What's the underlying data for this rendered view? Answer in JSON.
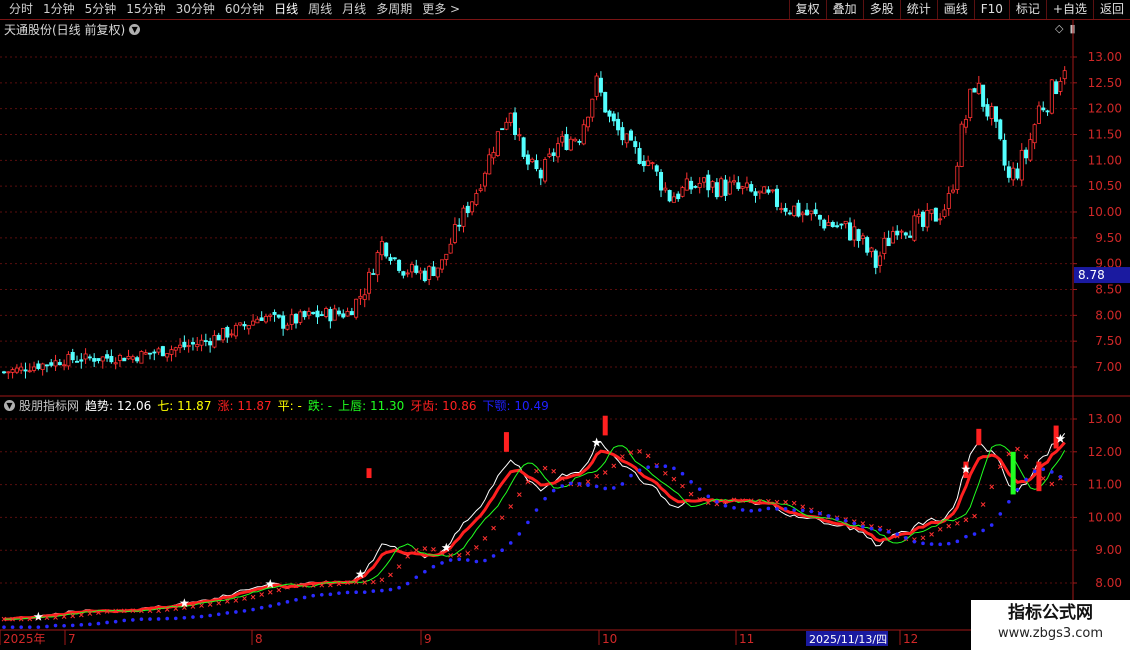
{
  "toolbar": {
    "periods": [
      "分时",
      "1分钟",
      "5分钟",
      "15分钟",
      "30分钟",
      "60分钟",
      "日线",
      "周线",
      "月线",
      "多周期",
      "更多 >"
    ],
    "active_period": "日线",
    "buttons": [
      "复权",
      "叠加",
      "多股",
      "统计",
      "画线",
      "F10",
      "标记",
      "+自选",
      "返回"
    ]
  },
  "main_panel": {
    "title": "天通股份(日线 前复权)",
    "current_price_tag": "8.78",
    "y_ticks": [
      "13.00",
      "12.50",
      "12.00",
      "11.50",
      "11.00",
      "10.50",
      "10.00",
      "9.50",
      "9.00",
      "8.50",
      "8.00",
      "7.50",
      "7.00"
    ],
    "icons": [
      "diamond-icon",
      "panel-toggle-icon"
    ]
  },
  "indicator_panel": {
    "name": "股朋指标网",
    "fields": [
      {
        "label": "趋势:",
        "value": "12.06",
        "color": "#ffffff"
      },
      {
        "label": "七:",
        "value": "11.87",
        "color": "#ffff00"
      },
      {
        "label": "涨:",
        "value": "11.87",
        "color": "#ff2020"
      },
      {
        "label": "平:",
        "value": "-",
        "color": "#ffff00"
      },
      {
        "label": "跌:",
        "value": "-",
        "color": "#20ff20"
      },
      {
        "label": "上唇:",
        "value": "11.30",
        "color": "#20ff20"
      },
      {
        "label": "牙齿:",
        "value": "10.86",
        "color": "#ff2020"
      },
      {
        "label": "下颚:",
        "value": "10.49",
        "color": "#2020ff"
      }
    ],
    "y_ticks": [
      "13.00",
      "12.00",
      "11.00",
      "10.00",
      "9.00",
      "8.00"
    ]
  },
  "x_axis": {
    "labels": [
      "2025年",
      "7",
      "8",
      "9",
      "10",
      "11",
      "12"
    ],
    "cursor_date": "2025/11/13/四"
  },
  "colors": {
    "up": "#ff3232",
    "down": "#54ffff",
    "grid": "#5a0e0e",
    "axis": "#a01818"
  },
  "watermark": {
    "title": "指标公式网",
    "url": "www.zbgs3.com"
  }
}
